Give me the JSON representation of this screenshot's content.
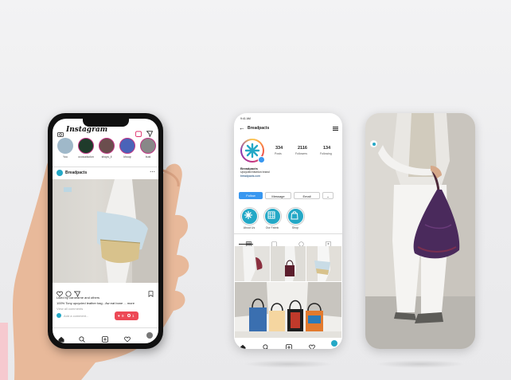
{
  "feed_phone": {
    "app_title": "Instagram",
    "stories": [
      {
        "label": "You",
        "color": "#9fb8c9"
      },
      {
        "label": "ocosodsolon",
        "color": "#1f3b2b"
      },
      {
        "label": "shops_li",
        "color": "#6b4e4e"
      },
      {
        "label": "khoup",
        "color": "#4a63b8"
      },
      {
        "label": "bust",
        "color": "#888888"
      }
    ],
    "post_author": "Breadpacts",
    "likes_text": "Liked by caroearne and others",
    "caption_text": "100% Tony upcycled leather bag - Aw eat bone ... more",
    "comments_text": "View all comments",
    "add_comment_placeholder": "Add a comment...",
    "notif_likes": "9",
    "notif_comments": "1",
    "nav_icons": [
      "home-icon",
      "search-icon",
      "add-icon",
      "heart-icon",
      "profile-icon"
    ]
  },
  "profile_phone": {
    "status_time": "9:41 AM",
    "username": "Breadpacts",
    "stats": [
      {
        "value": "334",
        "label": "Posts"
      },
      {
        "value": "2116",
        "label": "Followers"
      },
      {
        "value": "134",
        "label": "Following"
      }
    ],
    "bio_name": "Breadpacts",
    "bio_line1": "Upcycled fashion brand",
    "bio_link": "breadpacts.com",
    "follow_label": "Follow",
    "message_label": "Message",
    "email_label": "Email",
    "highlights": [
      {
        "label": "About Us"
      },
      {
        "label": "Our Fabric"
      },
      {
        "label": "Shop"
      }
    ],
    "accent_color": "#3897f0"
  }
}
